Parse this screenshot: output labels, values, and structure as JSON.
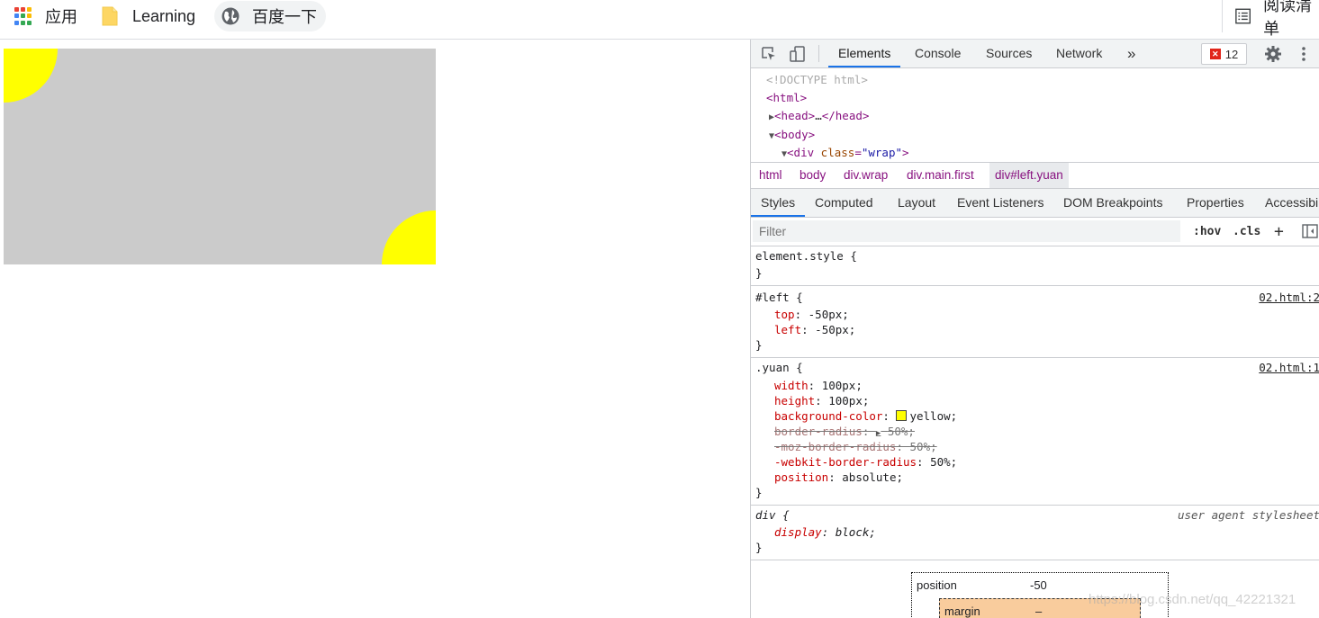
{
  "bookmarks": {
    "apps_label": "应用",
    "learning_label": "Learning",
    "baidu_label": "百度一下",
    "reading_label": "阅读清单"
  },
  "colors": {
    "wrap_bg": "#cbcbcb",
    "circle": "#ffff00",
    "accent": "#1a73e8"
  },
  "devtools": {
    "tabs": [
      "Elements",
      "Console",
      "Sources",
      "Network"
    ],
    "more_icon": "»",
    "error_count": "12",
    "dom": {
      "doctype": "<!DOCTYPE html>",
      "html_open": "<html>",
      "head_open": "<head>",
      "head_ellipsis": "…",
      "head_close": "</head>",
      "body_open": "<body>",
      "div_open": "<div",
      "div_attr": "class",
      "div_eq": "=",
      "div_val": "\"wrap\"",
      "div_end": ">"
    },
    "breadcrumbs": [
      "html",
      "body",
      "div.wrap",
      "div.main.first",
      "div#left.yuan"
    ],
    "sub_tabs": [
      "Styles",
      "Computed",
      "Layout",
      "Event Listeners",
      "DOM Breakpoints",
      "Properties",
      "Accessibility"
    ],
    "filter_placeholder": "Filter",
    "filter_hov": ":hov",
    "filter_cls": ".cls",
    "filter_plus": "+",
    "rules": {
      "element_style": {
        "selector": "element.style {",
        "close": "}"
      },
      "left": {
        "selector": "#left {",
        "source": "02.html:2",
        "props": [
          {
            "name": "top",
            "value": "-50px;"
          },
          {
            "name": "left",
            "value": "-50px;"
          }
        ],
        "close": "}"
      },
      "yuan": {
        "selector": ".yuan {",
        "source": "02.html:1",
        "width_name": "width",
        "width_val": "100px;",
        "height_name": "height",
        "height_val": "100px;",
        "bg_name": "background-color",
        "bg_val": "yellow;",
        "br_name": "border-radius",
        "br_val": "50%;",
        "moz_name": "-moz-border-radius",
        "moz_val": "50%;",
        "webkit_name": "-webkit-border-radius",
        "webkit_val": "50%;",
        "pos_name": "position",
        "pos_val": "absolute;",
        "close": "}"
      },
      "div_ua": {
        "selector": "div {",
        "source": "user agent stylesheet",
        "prop_name": "display",
        "prop_val": "block;",
        "close": "}"
      }
    },
    "box_model": {
      "position_label": "position",
      "position_value": "-50",
      "margin_label": "margin",
      "margin_value": "–"
    },
    "watermark": "https://blog.csdn.net/qq_42221321"
  }
}
